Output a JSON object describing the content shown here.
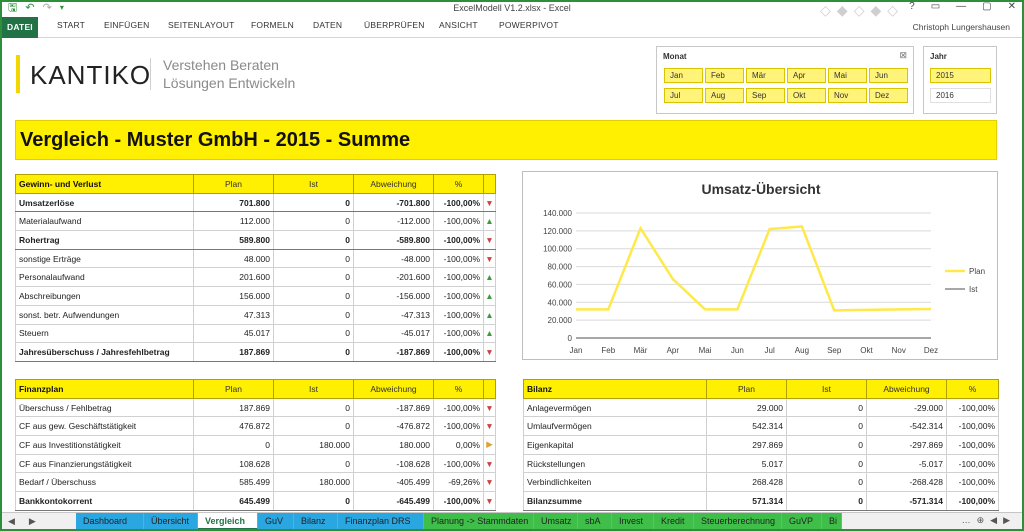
{
  "window": {
    "title": "ExcelModell V1.2.xlsx - Excel",
    "user": "Christoph Lungershausen",
    "controls": [
      "?",
      "▭",
      "—",
      "▢",
      "✕"
    ]
  },
  "qat_icons": [
    "save-icon",
    "undo-icon",
    "redo-icon",
    "customize-icon"
  ],
  "ribbon_tabs": [
    "DATEI",
    "START",
    "EINFÜGEN",
    "SEITENLAYOUT",
    "FORMELN",
    "DATEN",
    "ÜBERPRÜFEN",
    "ANSICHT",
    "POWERPIVOT"
  ],
  "logo": {
    "text": "KANTIKO",
    "tagline1": "Verstehen Beraten",
    "tagline2": "Lösungen Entwickeln"
  },
  "slicer_month": {
    "title": "Monat",
    "items": [
      "Jan",
      "Feb",
      "Mär",
      "Apr",
      "Mai",
      "Jun",
      "Jul",
      "Aug",
      "Sep",
      "Okt",
      "Nov",
      "Dez"
    ]
  },
  "slicer_year": {
    "title": "Jahr",
    "items": [
      "2015",
      "2016"
    ],
    "selected": "2015"
  },
  "page_title": "Vergleich - Muster GmbH - 2015 - Summe",
  "guv": {
    "header": [
      "Gewinn- und Verlust",
      "Plan",
      "Ist",
      "Abweichung",
      "%"
    ],
    "rows": [
      {
        "label": "Umsatzerlöse",
        "plan": "701.800",
        "ist": "0",
        "abw": "-701.800",
        "pct": "-100,00%",
        "arrow": "▼",
        "dir": "down",
        "bold": true
      },
      {
        "label": "Materialaufwand",
        "plan": "112.000",
        "ist": "0",
        "abw": "-112.000",
        "pct": "-100,00%",
        "arrow": "▲",
        "dir": "up",
        "bold": false
      },
      {
        "label": "Rohertrag",
        "plan": "589.800",
        "ist": "0",
        "abw": "-589.800",
        "pct": "-100,00%",
        "arrow": "▼",
        "dir": "down",
        "bold": true
      },
      {
        "label": "sonstige Erträge",
        "plan": "48.000",
        "ist": "0",
        "abw": "-48.000",
        "pct": "-100,00%",
        "arrow": "▼",
        "dir": "down",
        "bold": false
      },
      {
        "label": "Personalaufwand",
        "plan": "201.600",
        "ist": "0",
        "abw": "-201.600",
        "pct": "-100,00%",
        "arrow": "▲",
        "dir": "up",
        "bold": false
      },
      {
        "label": "Abschreibungen",
        "plan": "156.000",
        "ist": "0",
        "abw": "-156.000",
        "pct": "-100,00%",
        "arrow": "▲",
        "dir": "up",
        "bold": false
      },
      {
        "label": "sonst. betr. Aufwendungen",
        "plan": "47.313",
        "ist": "0",
        "abw": "-47.313",
        "pct": "-100,00%",
        "arrow": "▲",
        "dir": "up",
        "bold": false
      },
      {
        "label": "Steuern",
        "plan": "45.017",
        "ist": "0",
        "abw": "-45.017",
        "pct": "-100,00%",
        "arrow": "▲",
        "dir": "up",
        "bold": false
      },
      {
        "label": "Jahresüberschuss / Jahresfehlbetrag",
        "plan": "187.869",
        "ist": "0",
        "abw": "-187.869",
        "pct": "-100,00%",
        "arrow": "▼",
        "dir": "down",
        "bold": true
      }
    ]
  },
  "finanzplan": {
    "header": [
      "Finanzplan",
      "Plan",
      "Ist",
      "Abweichung",
      "%"
    ],
    "rows": [
      {
        "label": "Überschuss / Fehlbetrag",
        "plan": "187.869",
        "ist": "0",
        "abw": "-187.869",
        "pct": "-100,00%",
        "arrow": "▼",
        "dir": "down",
        "bold": false
      },
      {
        "label": "CF aus gew. Geschäftstätigkeit",
        "plan": "476.872",
        "ist": "0",
        "abw": "-476.872",
        "pct": "-100,00%",
        "arrow": "▼",
        "dir": "down",
        "bold": false
      },
      {
        "label": "CF aus Investitionstätigkeit",
        "plan": "0",
        "ist": "180.000",
        "abw": "180.000",
        "pct": "0,00%",
        "arrow": "▶",
        "dir": "right",
        "bold": false
      },
      {
        "label": "CF aus Finanzierungstätigkeit",
        "plan": "108.628",
        "ist": "0",
        "abw": "-108.628",
        "pct": "-100,00%",
        "arrow": "▼",
        "dir": "down",
        "bold": false
      },
      {
        "label": "Bedarf / Überschuss",
        "plan": "585.499",
        "ist": "180.000",
        "abw": "-405.499",
        "pct": "-69,26%",
        "arrow": "▼",
        "dir": "down",
        "bold": false
      },
      {
        "label": "Bankkontokorrent",
        "plan": "645.499",
        "ist": "0",
        "abw": "-645.499",
        "pct": "-100,00%",
        "arrow": "▼",
        "dir": "down",
        "bold": true
      }
    ]
  },
  "bilanz": {
    "header": [
      "Bilanz",
      "Plan",
      "Ist",
      "Abweichung",
      "%"
    ],
    "rows": [
      {
        "label": "Anlagevermögen",
        "plan": "29.000",
        "ist": "0",
        "abw": "-29.000",
        "pct": "-100,00%",
        "bold": false
      },
      {
        "label": "Umlaufvermögen",
        "plan": "542.314",
        "ist": "0",
        "abw": "-542.314",
        "pct": "-100,00%",
        "bold": false
      },
      {
        "label": "Eigenkapital",
        "plan": "297.869",
        "ist": "0",
        "abw": "-297.869",
        "pct": "-100,00%",
        "bold": false
      },
      {
        "label": "Rückstellungen",
        "plan": "5.017",
        "ist": "0",
        "abw": "-5.017",
        "pct": "-100,00%",
        "bold": false
      },
      {
        "label": "Verbindlichkeiten",
        "plan": "268.428",
        "ist": "0",
        "abw": "-268.428",
        "pct": "-100,00%",
        "bold": false
      },
      {
        "label": "Bilanzsumme",
        "plan": "571.314",
        "ist": "0",
        "abw": "-571.314",
        "pct": "-100,00%",
        "bold": true
      }
    ]
  },
  "chart_data": {
    "type": "line",
    "title": "Umsatz-Übersicht",
    "categories": [
      "Jan",
      "Feb",
      "Mär",
      "Apr",
      "Mai",
      "Jun",
      "Jul",
      "Aug",
      "Sep",
      "Okt",
      "Nov",
      "Dez"
    ],
    "ylim": [
      0,
      140000
    ],
    "yticks": [
      "0",
      "20.000",
      "40.000",
      "60.000",
      "80.000",
      "100.000",
      "120.000",
      "140.000"
    ],
    "grid": true,
    "legend_position": "right",
    "series": [
      {
        "name": "Plan",
        "color": "#ffe94a",
        "values": [
          32000,
          32000,
          123000,
          66000,
          32000,
          32000,
          122000,
          125000,
          31000,
          31500,
          32000,
          32500
        ]
      },
      {
        "name": "Ist",
        "color": "#8a8a8a",
        "values": [
          0,
          0,
          0,
          0,
          0,
          0,
          0,
          0,
          0,
          0,
          0,
          0
        ]
      }
    ]
  },
  "sheet_tabs": [
    {
      "label": "Dashboard",
      "style": "blue"
    },
    {
      "label": "Übersicht",
      "style": "blue"
    },
    {
      "label": "Vergleich",
      "style": "active"
    },
    {
      "label": "GuV",
      "style": "blue"
    },
    {
      "label": "Bilanz",
      "style": "blue"
    },
    {
      "label": "Finanzplan DRS",
      "style": "blue"
    },
    {
      "label": "Planung -> Stammdaten",
      "style": "green"
    },
    {
      "label": "Umsatz",
      "style": "green"
    },
    {
      "label": "sbA",
      "style": "green"
    },
    {
      "label": "Invest",
      "style": "green"
    },
    {
      "label": "Kredit",
      "style": "green"
    },
    {
      "label": "Steuerberechnung",
      "style": "green"
    },
    {
      "label": "GuVP",
      "style": "green"
    },
    {
      "label": "Bi",
      "style": "green"
    }
  ],
  "tab_nav": [
    "◀",
    "▶"
  ],
  "tab_right": [
    "…",
    "⊕",
    "◀",
    "▶"
  ]
}
